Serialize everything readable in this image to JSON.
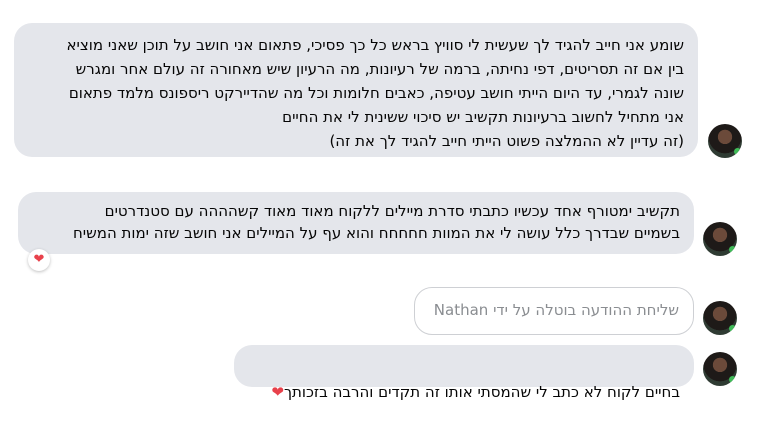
{
  "messages": [
    {
      "type": "text",
      "text": "שומע אני חייב להגיד לך שעשית לי סוויץ בראש כל כך פסיכי, פתאום אני חושב על תוכן שאני מוציא\nבין אם זה תסריטים, דפי נחיתה, ברמה של רעיונות, מה הרעיון שיש מאחורה זה עולם אחר ומגרש\nשונה לגמרי, עד היום הייתי חושב עטיפה, כאבים חלומות וכל מה שהדיירקט ריספונס מלמד פתאום\nאני מתחיל לחשוב ברעיונות תקשיב יש סיכוי ששינית לי את החיים\n(זה עדיין לא ההמלצה פשוט הייתי חייב להגיד לך את זה)"
    },
    {
      "type": "text",
      "text": "תקשיב ימטורף אחד עכשיו כתבתי סדרת מיילים ללקוח מאוד מאוד קשהההה עם סטנדרטים\nבשמיים שבדרך כלל עושה לי את המוות חחחחח והוא עף על המיילים אני חושב שזה ימות המשיח",
      "reaction": "❤"
    },
    {
      "type": "unsent",
      "text": "שליחת ההודעה בוטלה על ידי Nathan"
    },
    {
      "type": "text",
      "text": "בחיים לקוח לא כתב לי שהמסתי אותו זה תקדים והרבה בזכותך",
      "emoji": "❤"
    }
  ],
  "icons": {
    "avatar": "user-avatar",
    "reaction": "heart-icon"
  },
  "colors": {
    "bubble_bg": "#e4e6eb",
    "online_dot": "#3fbb57",
    "heart": "#e8414b"
  }
}
